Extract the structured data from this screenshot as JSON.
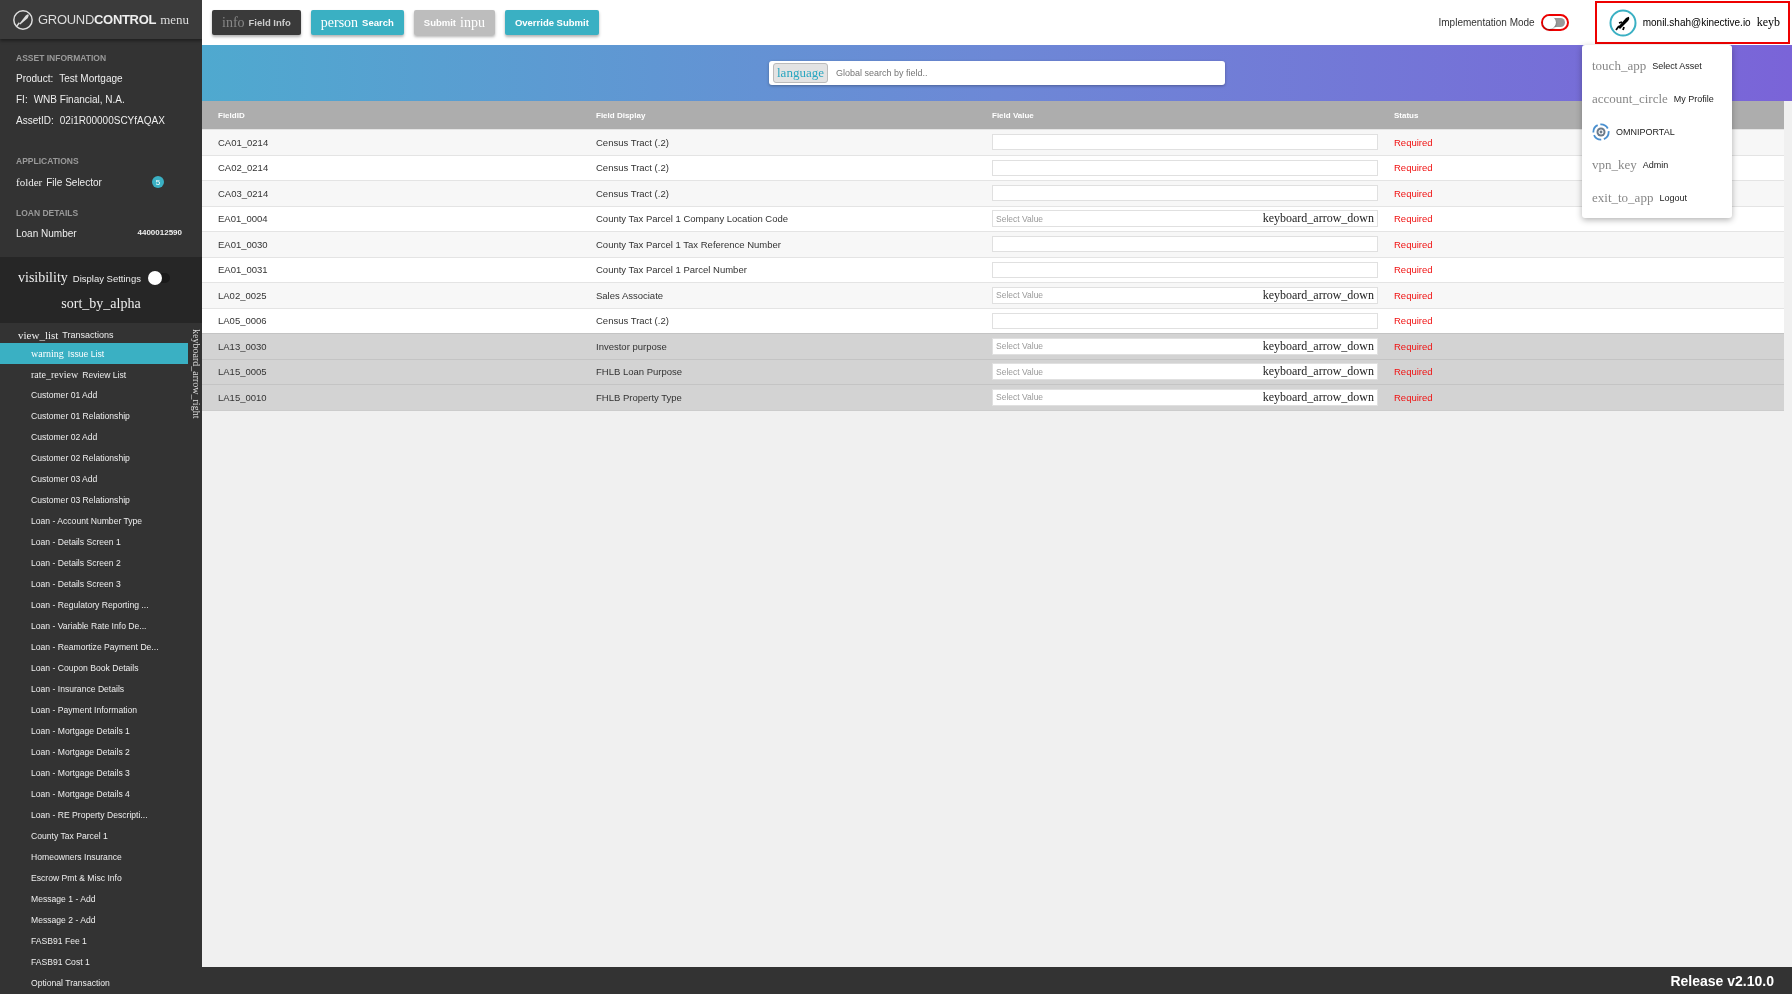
{
  "header": {
    "logo": "GROUND**CONTROL**",
    "menu_icon_text": "menu",
    "buttons": [
      {
        "kind": "dark",
        "icon_text": "info",
        "label": "Field Info"
      },
      {
        "kind": "teal",
        "icon_text": "person",
        "label": "Search"
      },
      {
        "kind": "grey",
        "label": "Submit",
        "trailing_text": "inpu"
      },
      {
        "kind": "teal",
        "label": "Override Submit"
      }
    ],
    "implementation_mode": {
      "label": "Implementation Mode",
      "on": false
    },
    "user": {
      "email": "monil.shah@kinective.io",
      "trailing_text": "keyb"
    }
  },
  "sidebar": {
    "asset_information": {
      "heading": "ASSET INFORMATION",
      "rows": [
        {
          "label": "Product:",
          "value": "Test Mortgage"
        },
        {
          "label": "FI:",
          "value": "WNB Financial, N.A."
        },
        {
          "label": "AssetID:",
          "value": "02i1R00000SCYfAQAX"
        }
      ]
    },
    "applications": {
      "heading": "APPLICATIONS",
      "items": [
        {
          "icon_text": "folder",
          "label": "File Selector",
          "badge": "5"
        }
      ]
    },
    "loan_details": {
      "heading": "LOAN DETAILS",
      "label": "Loan Number",
      "value": "4400012590"
    },
    "display_settings": {
      "icon_text": "visibility",
      "label": "Display Settings",
      "on": false,
      "sort_icon_text": "sort_by_alpha"
    },
    "transactions": {
      "icon_text": "view_list",
      "label": "Transactions",
      "collapse_icon_text": "keyboard_arrow_right",
      "items": [
        {
          "icon_text": "warning",
          "label": "Issue List",
          "selected": true
        },
        {
          "icon_text": "rate_review",
          "label": "Review List",
          "selected": false
        },
        {
          "label": "Customer 01 Add",
          "selected": false
        },
        {
          "label": "Customer 01 Relationship",
          "selected": false
        },
        {
          "label": "Customer 02 Add",
          "selected": false
        },
        {
          "label": "Customer 02 Relationship",
          "selected": false
        },
        {
          "label": "Customer 03 Add",
          "selected": false
        },
        {
          "label": "Customer 03 Relationship",
          "selected": false
        },
        {
          "label": "Loan - Account Number Type",
          "selected": false
        },
        {
          "label": "Loan - Details Screen 1",
          "selected": false
        },
        {
          "label": "Loan - Details Screen 2",
          "selected": false
        },
        {
          "label": "Loan - Details Screen 3",
          "selected": false
        },
        {
          "label": "Loan - Regulatory Reporting ...",
          "selected": false
        },
        {
          "label": "Loan - Variable Rate Info De...",
          "selected": false
        },
        {
          "label": "Loan - Reamortize Payment De...",
          "selected": false
        },
        {
          "label": "Loan - Coupon Book Details",
          "selected": false
        },
        {
          "label": "Loan - Insurance Details",
          "selected": false
        },
        {
          "label": "Loan - Payment Information",
          "selected": false
        },
        {
          "label": "Loan - Mortgage Details 1",
          "selected": false
        },
        {
          "label": "Loan - Mortgage Details 2",
          "selected": false
        },
        {
          "label": "Loan - Mortgage Details 3",
          "selected": false
        },
        {
          "label": "Loan - Mortgage Details 4",
          "selected": false
        },
        {
          "label": "Loan - RE Property Descripti...",
          "selected": false
        },
        {
          "label": "County Tax Parcel 1",
          "selected": false
        },
        {
          "label": "Homeowners Insurance",
          "selected": false
        },
        {
          "label": "Escrow Pmt & Misc Info",
          "selected": false
        },
        {
          "label": "Message 1 - Add",
          "selected": false
        },
        {
          "label": "Message 2 - Add",
          "selected": false
        },
        {
          "label": "FASB91 Fee 1",
          "selected": false
        },
        {
          "label": "FASB91 Cost 1",
          "selected": false
        },
        {
          "label": "Optional Transaction",
          "selected": false
        }
      ]
    }
  },
  "search": {
    "icon_text": "language",
    "placeholder": "Global search by field.."
  },
  "table": {
    "columns": [
      "FieldID",
      "Field Display",
      "Field Value",
      "Status"
    ],
    "rows": [
      {
        "field_id": "CA01_0214",
        "field_display": "Census Tract (.2)",
        "value": {
          "kind": "text"
        },
        "status": "Required",
        "shaded": false
      },
      {
        "field_id": "CA02_0214",
        "field_display": "Census Tract (.2)",
        "value": {
          "kind": "text"
        },
        "status": "Required",
        "shaded": false
      },
      {
        "field_id": "CA03_0214",
        "field_display": "Census Tract (.2)",
        "value": {
          "kind": "text"
        },
        "status": "Required",
        "shaded": false
      },
      {
        "field_id": "EA01_0004",
        "field_display": "County Tax Parcel 1 Company Location Code",
        "value": {
          "kind": "select",
          "placeholder": "Select Value",
          "arrow_text": "keyboard_arrow_down"
        },
        "status": "Required",
        "shaded": false
      },
      {
        "field_id": "EA01_0030",
        "field_display": "County Tax Parcel 1 Tax Reference Number",
        "value": {
          "kind": "text"
        },
        "status": "Required",
        "shaded": false
      },
      {
        "field_id": "EA01_0031",
        "field_display": "County Tax Parcel 1 Parcel Number",
        "value": {
          "kind": "text"
        },
        "status": "Required",
        "shaded": false
      },
      {
        "field_id": "LA02_0025",
        "field_display": "Sales Associate",
        "value": {
          "kind": "select",
          "placeholder": "Select Value",
          "arrow_text": "keyboard_arrow_down"
        },
        "status": "Required",
        "shaded": false
      },
      {
        "field_id": "LA05_0006",
        "field_display": "Census Tract (.2)",
        "value": {
          "kind": "text"
        },
        "status": "Required",
        "shaded": false
      },
      {
        "field_id": "LA13_0030",
        "field_display": "Investor purpose",
        "value": {
          "kind": "select",
          "placeholder": "Select Value",
          "arrow_text": "keyboard_arrow_down"
        },
        "status": "Required",
        "shaded": true
      },
      {
        "field_id": "LA15_0005",
        "field_display": "FHLB Loan Purpose",
        "value": {
          "kind": "select",
          "placeholder": "Select Value",
          "arrow_text": "keyboard_arrow_down"
        },
        "status": "Required",
        "shaded": true
      },
      {
        "field_id": "LA15_0010",
        "field_display": "FHLB Property Type",
        "value": {
          "kind": "select",
          "placeholder": "Select Value",
          "arrow_text": "keyboard_arrow_down"
        },
        "status": "Required",
        "shaded": true
      }
    ]
  },
  "user_menu": {
    "items": [
      {
        "kind": "text-icon",
        "icon_text": "touch_app",
        "label": "Select Asset"
      },
      {
        "kind": "text-icon",
        "icon_text": "account_circle",
        "label": "My Profile"
      },
      {
        "kind": "logo",
        "label": "OMNIPORTAL"
      },
      {
        "kind": "text-icon",
        "icon_text": "vpn_key",
        "label": "Admin"
      },
      {
        "kind": "text-icon",
        "icon_text": "exit_to_app",
        "label": "Logout"
      }
    ]
  },
  "footer": {
    "release": "Release v2.10.0"
  }
}
